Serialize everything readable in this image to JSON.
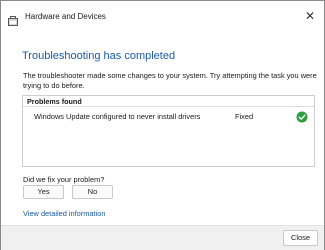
{
  "window": {
    "title": "Hardware and Devices",
    "close_glyph": "✕"
  },
  "content": {
    "heading": "Troubleshooting has completed",
    "description": "The troubleshooter made some changes to your system. Try attempting the task you were trying to do before."
  },
  "problems": {
    "header": "Problems found",
    "rows": [
      {
        "problem": "Windows Update configured to never install drivers",
        "status": "Fixed",
        "status_icon": "check-circle-icon"
      }
    ]
  },
  "feedback": {
    "question": "Did we fix your problem?",
    "yes_label": "Yes",
    "no_label": "No"
  },
  "details_link": "View detailed information",
  "footer": {
    "close_label": "Close"
  },
  "colors": {
    "accent": "#1a5aa8",
    "success": "#2e9e3e"
  }
}
